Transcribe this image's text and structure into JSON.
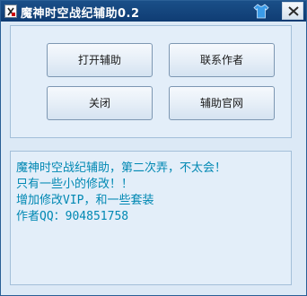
{
  "window": {
    "title": "魔神时空战纪辅助0.2"
  },
  "icons": {
    "app": "app-icon",
    "skin": "shirt-icon",
    "close": "close-icon"
  },
  "buttons": {
    "open": "打开辅助",
    "contact": "联系作者",
    "close": "关闭",
    "website": "辅助官网"
  },
  "message": {
    "lines": [
      "魔神时空战纪辅助，第二次弄，不太会！",
      "只有一些小的修改！！",
      "增加修改VIP，和一些套装",
      "作者QQ：904851758"
    ]
  },
  "colors": {
    "titlebar": "#1a4f88",
    "window_bg": "#dce9f6",
    "text": "#0088b3"
  }
}
